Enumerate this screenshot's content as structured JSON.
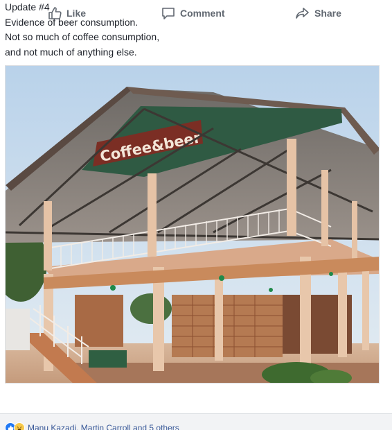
{
  "post": {
    "lines": [
      "Update #4",
      "Evidence of beer consumption.",
      "Not so much of coffee consumption,",
      "and not much of anything else."
    ]
  },
  "photo": {
    "sign_text": "Coffee&beer",
    "colors": {
      "sky": "#c9dcec",
      "roof_green": "#2f5a43",
      "wood": "#c98a5c",
      "post": "#e6c3a6",
      "floor": "#b87550",
      "shrub": "#3e6a2f"
    }
  },
  "actions": {
    "like_label": "Like",
    "comment_label": "Comment",
    "share_label": "Share"
  },
  "reactions": {
    "icons": [
      "like-reaction-icon",
      "haha-reaction-icon"
    ],
    "summary": "Manu Kazadi, Martin Carroll and 5 others"
  }
}
